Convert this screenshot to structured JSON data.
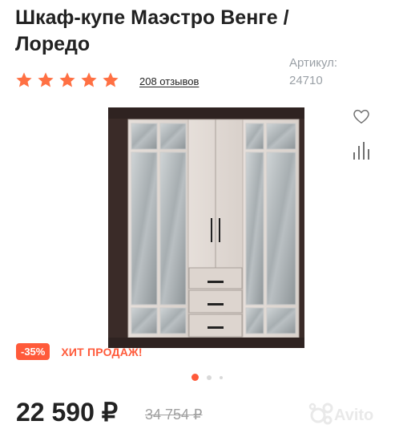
{
  "product": {
    "title": "Шкаф-купе Маэстро Венге / Лоредо",
    "rating": 5,
    "reviews": "208 отзывов",
    "article_label": "Артикул:",
    "article_value": "24710"
  },
  "badges": {
    "discount": "-35%",
    "hit": "ХИТ ПРОДАЖ!"
  },
  "gallery": {
    "slide_count": 3,
    "active_slide": 1
  },
  "pricing": {
    "price": "22 590 ₽",
    "old_price": "34 754 ₽"
  },
  "watermark": {
    "text": "Avito"
  },
  "colors": {
    "accent": "#ff5a3a",
    "muted": "#9aa0a6"
  },
  "icons": [
    "star-icon",
    "heart-icon",
    "compare-icon"
  ]
}
